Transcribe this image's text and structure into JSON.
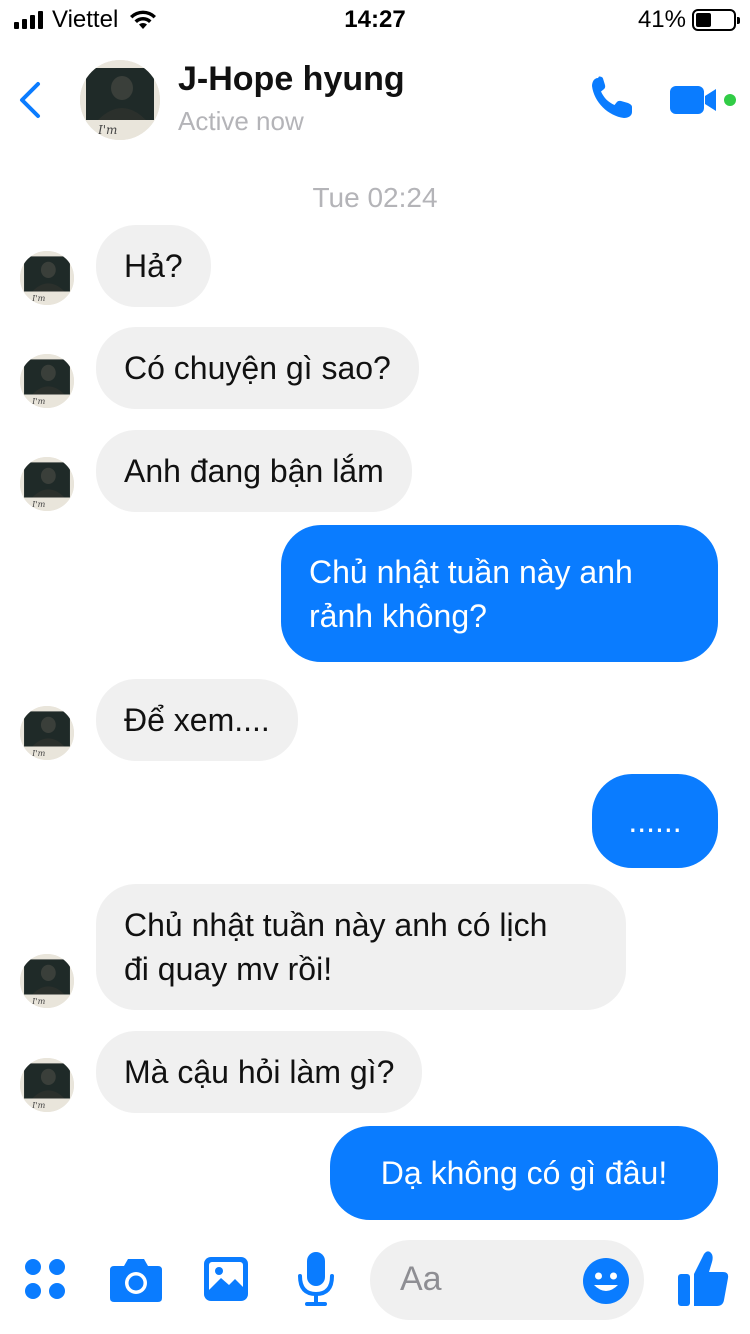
{
  "status_bar": {
    "carrier": "Viettel",
    "time": "14:27",
    "battery_percent_label": "41%",
    "battery_level": 0.41
  },
  "header": {
    "contact_name": "J-Hope hyung",
    "status": "Active now",
    "accent_color": "#0a7cff",
    "online_dot_color": "#31cc46"
  },
  "chat": {
    "timestamp": "Tue 02:24",
    "messages": [
      {
        "direction": "in",
        "lines": [
          "Hả?"
        ]
      },
      {
        "direction": "in",
        "lines": [
          "Có chuyện gì sao?"
        ]
      },
      {
        "direction": "in",
        "lines": [
          "Anh đang bận lắm"
        ]
      },
      {
        "direction": "out",
        "lines": [
          "Chủ nhật tuần này anh",
          "rảnh không?"
        ]
      },
      {
        "direction": "in",
        "lines": [
          "Để xem...."
        ]
      },
      {
        "direction": "out",
        "lines": [
          "......"
        ]
      },
      {
        "direction": "in",
        "lines": [
          "Chủ nhật tuần này anh có lịch",
          "đi quay mv rồi!"
        ]
      },
      {
        "direction": "in",
        "lines": [
          "Mà cậu hỏi làm gì?"
        ]
      },
      {
        "direction": "out",
        "lines": [
          "Dạ không có gì đâu!"
        ]
      }
    ],
    "incoming_bubble_color": "#f0f0f0",
    "outgoing_bubble_color": "#0a7cff"
  },
  "composer": {
    "placeholder": "Aa",
    "icons": [
      "more-apps-icon",
      "camera-icon",
      "photo-icon",
      "microphone-icon",
      "emoji-icon",
      "like-icon"
    ]
  }
}
